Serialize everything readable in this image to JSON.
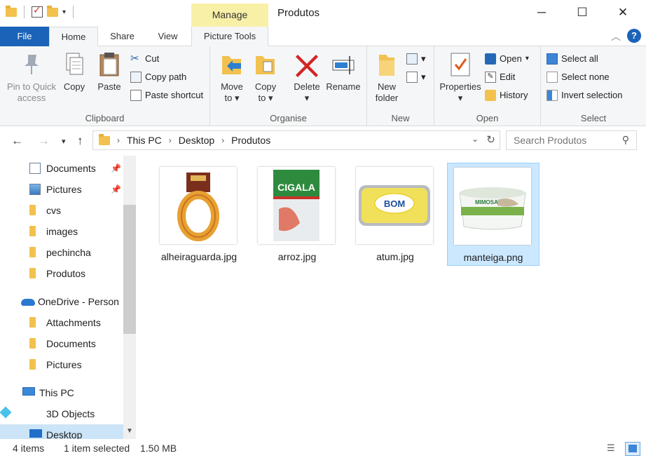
{
  "window": {
    "title": "Produtos",
    "contextual_tab_group": "Manage",
    "minimize": "─",
    "maximize": "☐",
    "close": "✕"
  },
  "ribbon_tabs": [
    "File",
    "Home",
    "Share",
    "View",
    "Picture Tools"
  ],
  "ribbon": {
    "clipboard": {
      "label": "Clipboard",
      "pin": "Pin to Quick access",
      "pin_l1": "Pin to Quick",
      "pin_l2": "access",
      "copy": "Copy",
      "paste": "Paste",
      "cut": "Cut",
      "copy_path": "Copy path",
      "paste_shortcut": "Paste shortcut"
    },
    "organise": {
      "label": "Organise",
      "move_to_l1": "Move",
      "move_to_l2": "to",
      "copy_to_l1": "Copy",
      "copy_to_l2": "to",
      "delete": "Delete",
      "rename": "Rename"
    },
    "new": {
      "label": "New",
      "new_folder_l1": "New",
      "new_folder_l2": "folder"
    },
    "open": {
      "label": "Open",
      "properties": "Properties",
      "open": "Open",
      "edit": "Edit",
      "history": "History"
    },
    "select": {
      "label": "Select",
      "select_all": "Select all",
      "select_none": "Select none",
      "invert": "Invert selection"
    }
  },
  "address": {
    "crumbs": [
      "This PC",
      "Desktop",
      "Produtos"
    ],
    "search_placeholder": "Search Produtos"
  },
  "nav": {
    "items": [
      {
        "label": "Documents",
        "icon": "documents-icon",
        "pinned": true
      },
      {
        "label": "Pictures",
        "icon": "pictures-icon",
        "pinned": true
      },
      {
        "label": "cvs",
        "icon": "folder-icon"
      },
      {
        "label": "images",
        "icon": "folder-icon"
      },
      {
        "label": "pechincha",
        "icon": "folder-icon"
      },
      {
        "label": "Produtos",
        "icon": "folder-icon"
      },
      {
        "label": "OneDrive - Person",
        "icon": "onedrive-icon"
      },
      {
        "label": "Attachments",
        "icon": "folder-icon"
      },
      {
        "label": "Documents",
        "icon": "folder-icon"
      },
      {
        "label": "Pictures",
        "icon": "folder-icon"
      },
      {
        "label": "This PC",
        "icon": "this-pc-icon"
      },
      {
        "label": "3D Objects",
        "icon": "3d-objects-icon"
      },
      {
        "label": "Desktop",
        "icon": "desktop-icon",
        "selected": true
      }
    ]
  },
  "files": [
    {
      "name": "alheiraguarda.jpg",
      "selected": false
    },
    {
      "name": "arroz.jpg",
      "selected": false
    },
    {
      "name": "atum.jpg",
      "selected": false
    },
    {
      "name": "manteiga.png",
      "selected": true
    }
  ],
  "thumb_text": {
    "arroz_brand": "CIGALA",
    "atum_brand": "BOM",
    "manteiga_brand": "MIMOSA"
  },
  "status": {
    "count": "4 items",
    "selection": "1 item selected",
    "size": "1.50 MB"
  },
  "colors": {
    "accent": "#1a63b8",
    "selection": "#cce8ff",
    "manage": "#f9f0a8"
  }
}
